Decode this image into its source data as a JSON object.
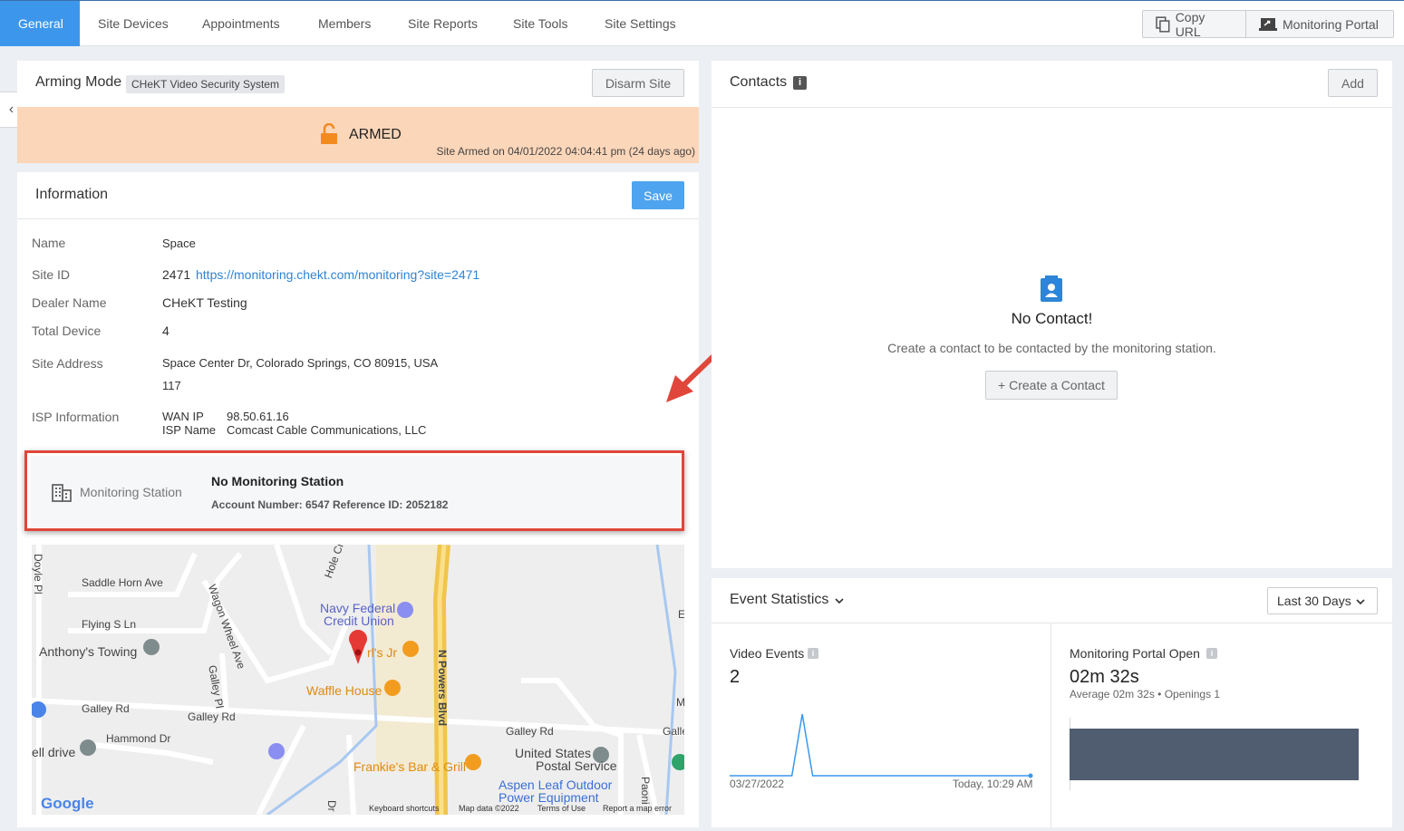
{
  "tabs": [
    "General",
    "Site Devices",
    "Appointments",
    "Members",
    "Site Reports",
    "Site Tools",
    "Site Settings"
  ],
  "top_buttons": {
    "copy_url": "Copy URL",
    "monitoring_portal": "Monitoring Portal"
  },
  "arming": {
    "title": "Arming Mode",
    "system_badge": "CHeKT Video Security System",
    "disarm_label": "Disarm Site",
    "status": "ARMED",
    "armed_note": "Site Armed on 04/01/2022 04:04:41 pm (24 days ago)",
    "status_color": "#fcd6b9"
  },
  "information": {
    "title": "Information",
    "save_label": "Save",
    "name_label": "Name",
    "name_value": "Space",
    "site_id_label": "Site ID",
    "site_id_value": "2471",
    "site_id_link": "https://monitoring.chekt.com/monitoring?site=2471",
    "dealer_label": "Dealer Name",
    "dealer_value": "CHeKT Testing",
    "total_device_label": "Total Device",
    "total_device_value": "4",
    "address_label": "Site Address",
    "address_line1": "Space Center Dr, Colorado Springs, CO 80915, USA",
    "address_line2": "117",
    "isp_label": "ISP Information",
    "wan_ip_label": "WAN IP",
    "wan_ip_value": "98.50.61.16",
    "isp_name_label": "ISP Name",
    "isp_name_value": "Comcast Cable Communications, LLC"
  },
  "monitoring_station": {
    "label": "Monitoring Station",
    "name": "No Monitoring Station",
    "account_number": "Account Number: 6547",
    "reference_id": "Reference ID: 2052182",
    "highlight_color": "#e0463a"
  },
  "map": {
    "labels": {
      "doyle": "Doyle Pl",
      "saddle": "Saddle Horn Ave",
      "hole": "Hole Cir",
      "navy1": "Navy Federal",
      "navy2": "Credit Union",
      "flying": "Flying S Ln",
      "wagon": "Wagon Wheel Ave",
      "anthony": "Anthony's Towing",
      "carls": "rl's Jr",
      "npowers": "N Powers Blvd",
      "galleypl": "Galley Pl",
      "waffle": "Waffle House",
      "galley_rd1": "Galley Rd",
      "galley_rd2": "Galley Rd",
      "galley_rd3": "Galley Rd",
      "galley_rd4": "Galle",
      "hammond": "Hammond Dr",
      "well": "ell drive",
      "ups1": "United States",
      "ups2": "Postal Service",
      "frankie": "Frankie's Bar & Grill",
      "aspen1": "Aspen Leaf Outdoor",
      "aspen2": "Power Equipment",
      "dr": "Dr",
      "paoni": "Paoni",
      "e_edge": "E",
      "m_edge": "M",
      "google": "Google",
      "kbd": "Keyboard shortcuts",
      "mapdata": "Map data ©2022",
      "terms": "Terms of Use",
      "report": "Report a map error"
    }
  },
  "contacts": {
    "title": "Contacts",
    "add_label": "Add",
    "empty_title": "No Contact!",
    "empty_text": "Create a contact to be contacted by the monitoring station.",
    "create_label": "+ Create a Contact"
  },
  "event_statistics": {
    "title": "Event Statistics",
    "range": "Last 30 Days",
    "video_events": {
      "label": "Video Events",
      "value": "2",
      "start_date": "03/27/2022",
      "end_date": "Today, 10:29 AM"
    },
    "portal_open": {
      "label": "Monitoring Portal Open",
      "value": "02m 32s",
      "sub": "Average 02m 32s • Openings 1"
    }
  },
  "chart_data": {
    "type": "line",
    "x": [
      "03/27/2022",
      "",
      "",
      "",
      "",
      "",
      "",
      "",
      "",
      "",
      "",
      "",
      "",
      "",
      "",
      "",
      "",
      "",
      "",
      "",
      "",
      "",
      "",
      "",
      "",
      "",
      "",
      "",
      "",
      "Today, 10:29 AM"
    ],
    "values": [
      0,
      0,
      0,
      0,
      0,
      0,
      0,
      2,
      0,
      0,
      0,
      0,
      0,
      0,
      0,
      0,
      0,
      0,
      0,
      0,
      0,
      0,
      0,
      0,
      0,
      0,
      0,
      0,
      0,
      0
    ],
    "title": "",
    "xlabel": "",
    "ylabel": "",
    "ylim": [
      0,
      2
    ],
    "color": "#3c97ec"
  }
}
